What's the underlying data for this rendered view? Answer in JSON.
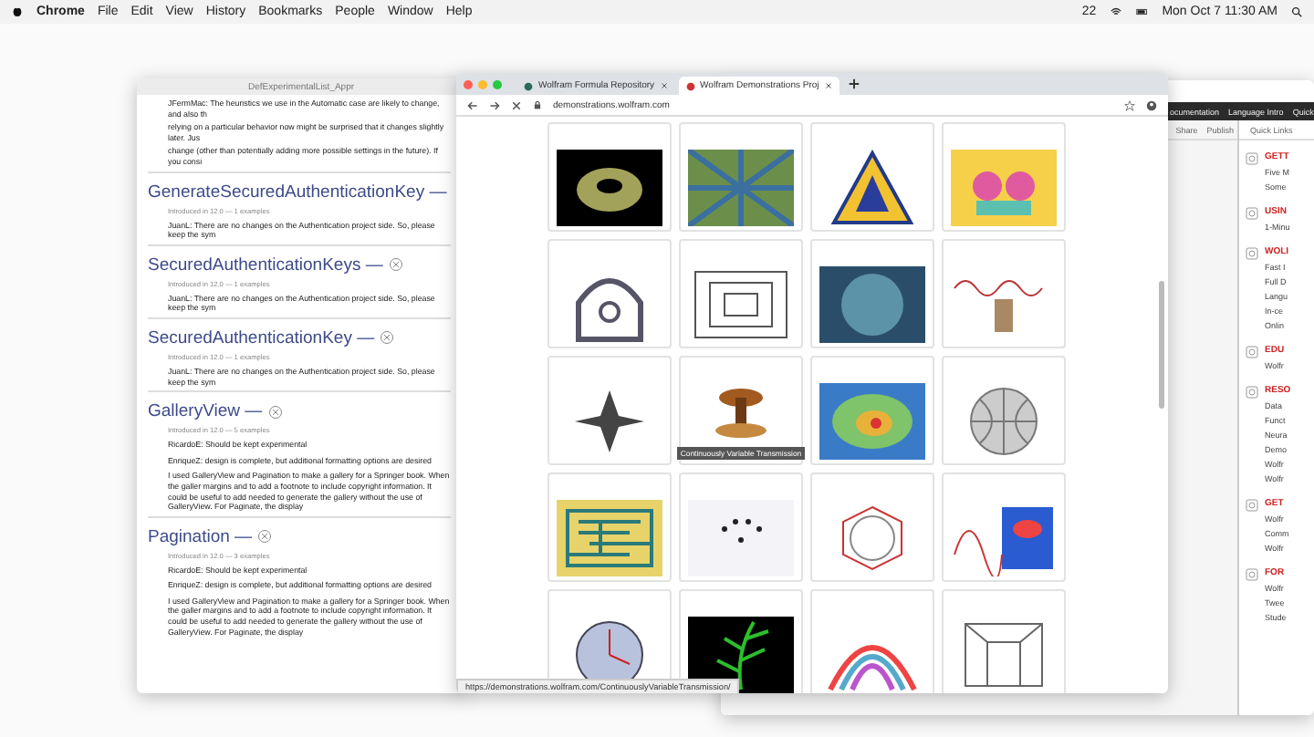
{
  "menu_bar": {
    "app": "Chrome",
    "items": [
      "File",
      "Edit",
      "View",
      "History",
      "Bookmarks",
      "People",
      "Window",
      "Help"
    ],
    "badge": "22",
    "clock": "Mon Oct 7  11:30 AM"
  },
  "notebook": {
    "title": "DefExperimentalList_Appr",
    "intro": [
      "JFermMac: The heuristics we use in the Automatic case are likely to change, and also th",
      "relying on a particular behavior now might be surprised that it changes slightly later. Jus",
      "change (other than potentially adding more possible settings in the future). If you consi"
    ],
    "sections": [
      {
        "name": "GenerateSecuredAuthenticationKey —",
        "meta": "Introduced in 12.0 — 1 examples",
        "notes": [
          "JuanL: There are no changes on the Authentication project side. So, please keep the sym"
        ]
      },
      {
        "name": "SecuredAuthenticationKeys —",
        "meta": "Introduced in 12.0 — 1 examples",
        "notes": [
          "JuanL: There are no changes on the Authentication project side. So, please keep the sym"
        ]
      },
      {
        "name": "SecuredAuthenticationKey —",
        "meta": "Introduced in 12.0 — 1 examples",
        "notes": [
          "JuanL: There are no changes on the Authentication project side. So, please keep the sym"
        ]
      },
      {
        "name": "GalleryView —",
        "meta": "Introduced in 12.0 — 5 examples",
        "notes": [
          "RicardoE: Should be kept experimental",
          "EnriqueZ: design is complete, but additional formatting options are desired",
          "I used GalleryView and Pagination to make a gallery for a Springer book. When the galler margins and to add a footnote to include copyright information. It could be useful to add needed to generate the gallery without the use of GalleryView. For Paginate, the display"
        ]
      },
      {
        "name": "Pagination —",
        "meta": "Introduced in 12.0 — 3 examples",
        "notes": [
          "RicardoE: Should be kept experimental",
          "EnriqueZ: design is complete, but additional formatting options are desired",
          "I used GalleryView and Pagination to make a gallery for a Springer book. When the galler margins and to add a footnote to include copyright information. It could be useful to add needed to generate the gallery without the use of GalleryView. For Paginate, the display"
        ]
      }
    ]
  },
  "browser": {
    "tabs": [
      {
        "label": "Wolfram Formula Repository",
        "selected": false
      },
      {
        "label": "Wolfram Demonstrations Proj",
        "selected": true
      }
    ],
    "url": "demonstrations.wolfram.com",
    "cards": [
      {
        "kind": "torus"
      },
      {
        "kind": "pattern"
      },
      {
        "kind": "star"
      },
      {
        "kind": "mask"
      },
      {
        "kind": "arch"
      },
      {
        "kind": "squares"
      },
      {
        "kind": "disk"
      },
      {
        "kind": "wave"
      },
      {
        "kind": "polyhedron"
      },
      {
        "kind": "captioned",
        "caption": "Continuously Variable Transmission"
      },
      {
        "kind": "heatmap"
      },
      {
        "kind": "sphere"
      },
      {
        "kind": "maze"
      },
      {
        "kind": "dots"
      },
      {
        "kind": "polygon"
      },
      {
        "kind": "plot"
      },
      {
        "kind": "clock"
      },
      {
        "kind": "fern"
      },
      {
        "kind": "rainbow"
      },
      {
        "kind": "frame"
      }
    ],
    "status_url": "https://demonstrations.wolfram.com/ContinuouslyVariableTransmission/"
  },
  "wolfram_window": {
    "toolbar": [
      "ocumentation",
      "Language Intro",
      "Quick"
    ],
    "actions": [
      "Share",
      "Publish"
    ],
    "quick_links": "Quick Links",
    "groups": [
      {
        "heading": "GETT",
        "lines": [
          "Five M",
          "Some"
        ]
      },
      {
        "heading": "USIN",
        "lines": [
          "1-Minu"
        ]
      },
      {
        "heading": "WOLI",
        "lines": [
          "Fast I",
          "Full D",
          "Langu",
          "In-ce",
          "Onlin"
        ]
      },
      {
        "heading": "EDU",
        "lines": [
          "Wolfr"
        ]
      },
      {
        "heading": "RESO",
        "lines": [
          "Data",
          "Funct",
          "Neura",
          "Demo",
          "Wolfr",
          "Wolfr"
        ]
      },
      {
        "heading": "GET",
        "lines": [
          "Wolfr",
          "Comm",
          "Wolfr"
        ]
      },
      {
        "heading": "FOR",
        "lines": [
          "Wolfr",
          "Twee",
          "Stude"
        ]
      }
    ]
  }
}
